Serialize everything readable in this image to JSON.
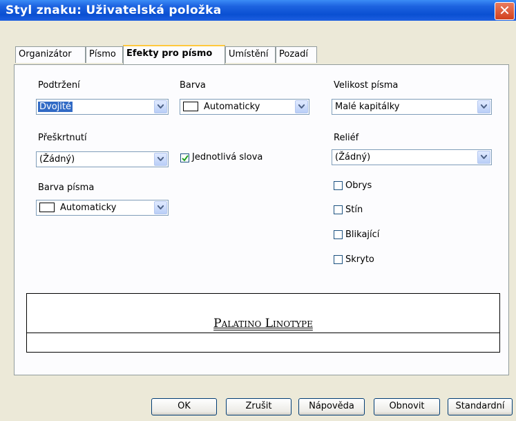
{
  "window": {
    "title": "Styl znaku: Uživatelská položka",
    "close_glyph": "✕"
  },
  "tabs": [
    {
      "label": "Organizátor",
      "active": false
    },
    {
      "label": "Písmo",
      "active": false
    },
    {
      "label": "Efekty pro písmo",
      "active": true
    },
    {
      "label": "Umístění",
      "active": false
    },
    {
      "label": "Pozadí",
      "active": false
    }
  ],
  "underline": {
    "label": "Podtržení",
    "value": "Dvojité"
  },
  "strikethrough": {
    "label": "Přeškrtnutí",
    "value": "(Žádný)"
  },
  "font_color": {
    "label": "Barva písma",
    "value": "Automaticky",
    "swatch": "#ffffff"
  },
  "color": {
    "label": "Barva",
    "value": "Automaticky",
    "swatch": "#ffffff"
  },
  "individual_words": {
    "label": "Jednotlivá slova",
    "checked": true
  },
  "font_size": {
    "label": "Velikost písma",
    "value": "Malé kapitálky"
  },
  "relief": {
    "label": "Reliéf",
    "value": "(Žádný)"
  },
  "outline": {
    "label": "Obrys",
    "checked": false
  },
  "shadow": {
    "label": "Stín",
    "checked": false
  },
  "blinking": {
    "label": "Blikající",
    "checked": false
  },
  "hidden": {
    "label": "Skryto",
    "checked": false
  },
  "preview": {
    "text": "Palatino Linotype"
  },
  "buttons": {
    "ok": "OK",
    "cancel": "Zrušit",
    "help": "Nápověda",
    "reset": "Obnovit",
    "standard": "Standardní"
  },
  "colors": {
    "title_bar": "#0a4fd2",
    "accent": "#316ac5",
    "check": "#21a121",
    "tab_highlight": "#ffc83c"
  }
}
